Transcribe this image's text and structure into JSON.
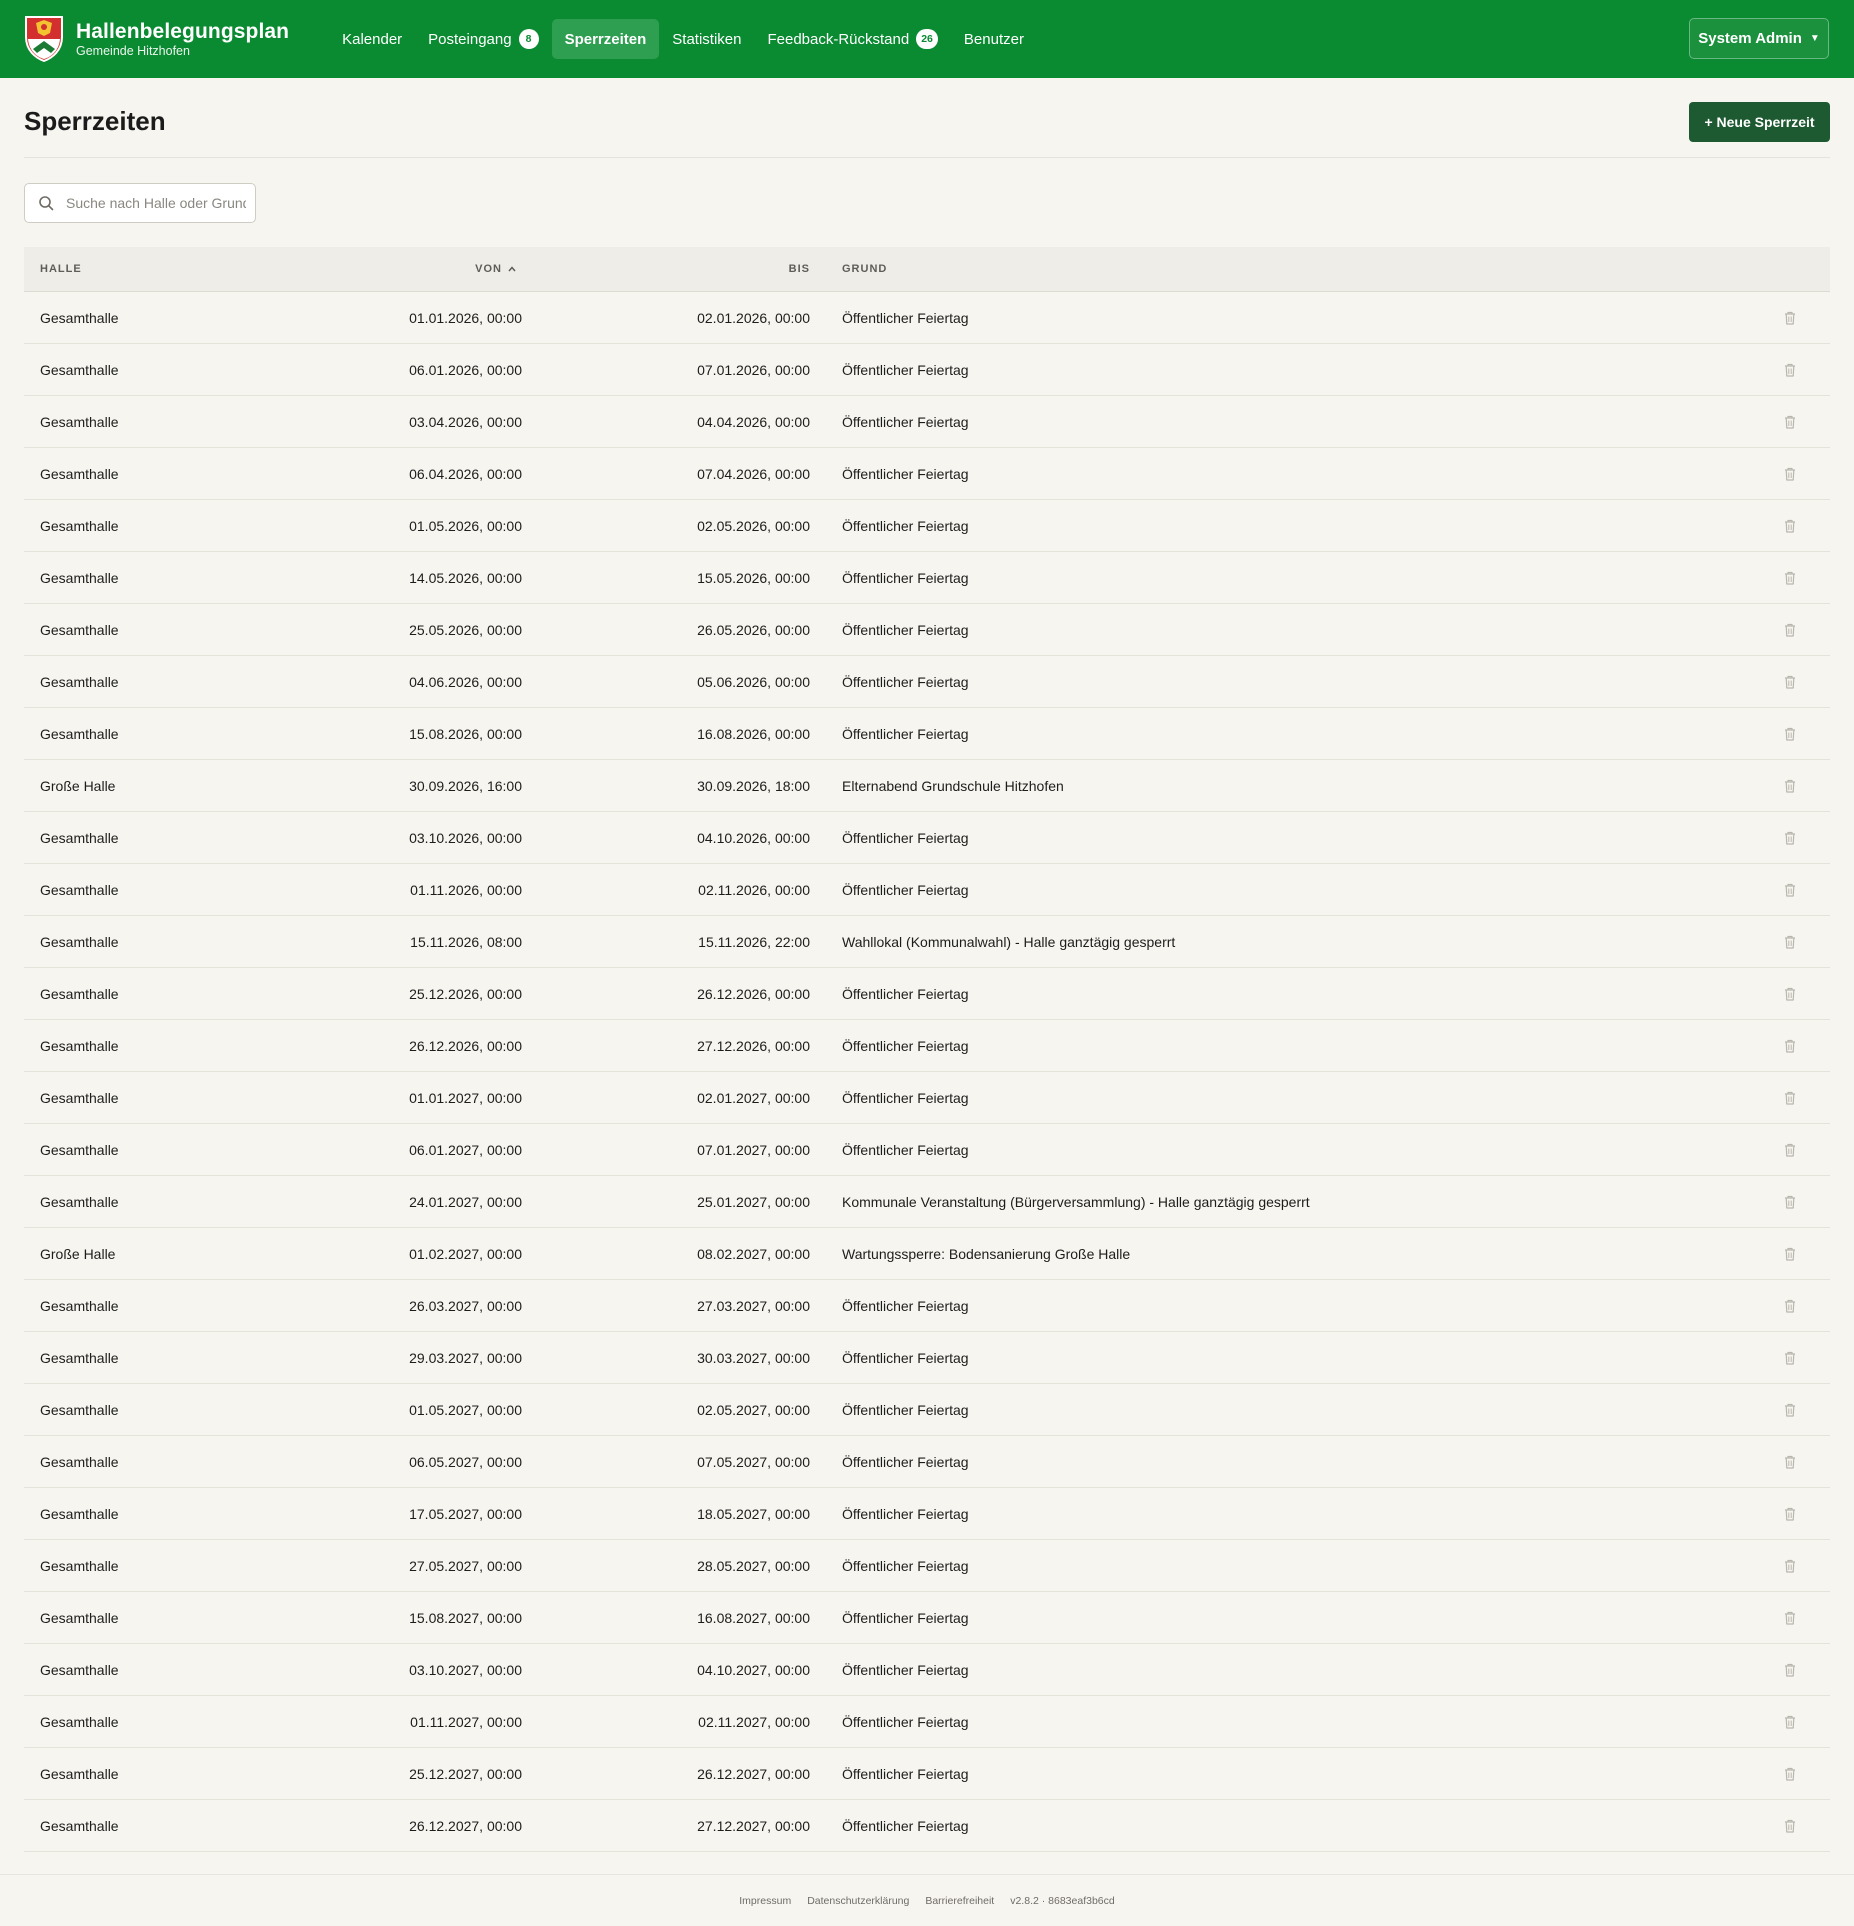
{
  "app": {
    "title": "Hallenbelegungsplan",
    "subtitle": "Gemeinde Hitzhofen",
    "brand_color": "#0a8a31"
  },
  "nav": {
    "kalender": "Kalender",
    "posteingang": "Posteingang",
    "posteingang_count": "8",
    "sperrzeiten": "Sperrzeiten",
    "statistiken": "Statistiken",
    "feedback": "Feedback-Rückstand",
    "feedback_count": "26",
    "benutzer": "Benutzer",
    "active": "Sperrzeiten"
  },
  "user": {
    "name": "System Admin"
  },
  "page": {
    "title": "Sperrzeiten",
    "new_button": "+ Neue Sperrzeit",
    "search_placeholder": "Suche nach Halle oder Grund"
  },
  "table": {
    "headers": {
      "halle": "HALLE",
      "von": "VON",
      "bis": "BIS",
      "grund": "GRUND"
    },
    "sort": {
      "column": "von",
      "direction": "asc"
    },
    "rows": [
      {
        "halle": "Gesamthalle",
        "von": "01.01.2026, 00:00",
        "bis": "02.01.2026, 00:00",
        "grund": "Öffentlicher Feiertag"
      },
      {
        "halle": "Gesamthalle",
        "von": "06.01.2026, 00:00",
        "bis": "07.01.2026, 00:00",
        "grund": "Öffentlicher Feiertag"
      },
      {
        "halle": "Gesamthalle",
        "von": "03.04.2026, 00:00",
        "bis": "04.04.2026, 00:00",
        "grund": "Öffentlicher Feiertag"
      },
      {
        "halle": "Gesamthalle",
        "von": "06.04.2026, 00:00",
        "bis": "07.04.2026, 00:00",
        "grund": "Öffentlicher Feiertag"
      },
      {
        "halle": "Gesamthalle",
        "von": "01.05.2026, 00:00",
        "bis": "02.05.2026, 00:00",
        "grund": "Öffentlicher Feiertag"
      },
      {
        "halle": "Gesamthalle",
        "von": "14.05.2026, 00:00",
        "bis": "15.05.2026, 00:00",
        "grund": "Öffentlicher Feiertag"
      },
      {
        "halle": "Gesamthalle",
        "von": "25.05.2026, 00:00",
        "bis": "26.05.2026, 00:00",
        "grund": "Öffentlicher Feiertag"
      },
      {
        "halle": "Gesamthalle",
        "von": "04.06.2026, 00:00",
        "bis": "05.06.2026, 00:00",
        "grund": "Öffentlicher Feiertag"
      },
      {
        "halle": "Gesamthalle",
        "von": "15.08.2026, 00:00",
        "bis": "16.08.2026, 00:00",
        "grund": "Öffentlicher Feiertag"
      },
      {
        "halle": "Große Halle",
        "von": "30.09.2026, 16:00",
        "bis": "30.09.2026, 18:00",
        "grund": "Elternabend Grundschule Hitzhofen"
      },
      {
        "halle": "Gesamthalle",
        "von": "03.10.2026, 00:00",
        "bis": "04.10.2026, 00:00",
        "grund": "Öffentlicher Feiertag"
      },
      {
        "halle": "Gesamthalle",
        "von": "01.11.2026, 00:00",
        "bis": "02.11.2026, 00:00",
        "grund": "Öffentlicher Feiertag"
      },
      {
        "halle": "Gesamthalle",
        "von": "15.11.2026, 08:00",
        "bis": "15.11.2026, 22:00",
        "grund": "Wahllokal (Kommunalwahl) - Halle ganztägig gesperrt"
      },
      {
        "halle": "Gesamthalle",
        "von": "25.12.2026, 00:00",
        "bis": "26.12.2026, 00:00",
        "grund": "Öffentlicher Feiertag"
      },
      {
        "halle": "Gesamthalle",
        "von": "26.12.2026, 00:00",
        "bis": "27.12.2026, 00:00",
        "grund": "Öffentlicher Feiertag"
      },
      {
        "halle": "Gesamthalle",
        "von": "01.01.2027, 00:00",
        "bis": "02.01.2027, 00:00",
        "grund": "Öffentlicher Feiertag"
      },
      {
        "halle": "Gesamthalle",
        "von": "06.01.2027, 00:00",
        "bis": "07.01.2027, 00:00",
        "grund": "Öffentlicher Feiertag"
      },
      {
        "halle": "Gesamthalle",
        "von": "24.01.2027, 00:00",
        "bis": "25.01.2027, 00:00",
        "grund": "Kommunale Veranstaltung (Bürgerversammlung) - Halle ganztägig gesperrt"
      },
      {
        "halle": "Große Halle",
        "von": "01.02.2027, 00:00",
        "bis": "08.02.2027, 00:00",
        "grund": "Wartungssperre: Bodensanierung Große Halle"
      },
      {
        "halle": "Gesamthalle",
        "von": "26.03.2027, 00:00",
        "bis": "27.03.2027, 00:00",
        "grund": "Öffentlicher Feiertag"
      },
      {
        "halle": "Gesamthalle",
        "von": "29.03.2027, 00:00",
        "bis": "30.03.2027, 00:00",
        "grund": "Öffentlicher Feiertag"
      },
      {
        "halle": "Gesamthalle",
        "von": "01.05.2027, 00:00",
        "bis": "02.05.2027, 00:00",
        "grund": "Öffentlicher Feiertag"
      },
      {
        "halle": "Gesamthalle",
        "von": "06.05.2027, 00:00",
        "bis": "07.05.2027, 00:00",
        "grund": "Öffentlicher Feiertag"
      },
      {
        "halle": "Gesamthalle",
        "von": "17.05.2027, 00:00",
        "bis": "18.05.2027, 00:00",
        "grund": "Öffentlicher Feiertag"
      },
      {
        "halle": "Gesamthalle",
        "von": "27.05.2027, 00:00",
        "bis": "28.05.2027, 00:00",
        "grund": "Öffentlicher Feiertag"
      },
      {
        "halle": "Gesamthalle",
        "von": "15.08.2027, 00:00",
        "bis": "16.08.2027, 00:00",
        "grund": "Öffentlicher Feiertag"
      },
      {
        "halle": "Gesamthalle",
        "von": "03.10.2027, 00:00",
        "bis": "04.10.2027, 00:00",
        "grund": "Öffentlicher Feiertag"
      },
      {
        "halle": "Gesamthalle",
        "von": "01.11.2027, 00:00",
        "bis": "02.11.2027, 00:00",
        "grund": "Öffentlicher Feiertag"
      },
      {
        "halle": "Gesamthalle",
        "von": "25.12.2027, 00:00",
        "bis": "26.12.2027, 00:00",
        "grund": "Öffentlicher Feiertag"
      },
      {
        "halle": "Gesamthalle",
        "von": "26.12.2027, 00:00",
        "bis": "27.12.2027, 00:00",
        "grund": "Öffentlicher Feiertag"
      }
    ]
  },
  "footer": {
    "impressum": "Impressum",
    "datenschutz": "Datenschutzerklärung",
    "barrierefreiheit": "Barrierefreiheit",
    "version": "v2.8.2 · 8683eaf3b6cd"
  }
}
